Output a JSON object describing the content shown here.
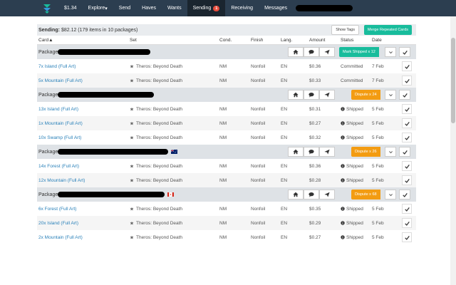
{
  "nav": {
    "balance": "$1.34",
    "items": [
      {
        "label": "Explore",
        "dropdown": true
      },
      {
        "label": "Send"
      },
      {
        "label": "Haves"
      },
      {
        "label": "Wants"
      },
      {
        "label": "Sending",
        "badge": "1",
        "active": true
      },
      {
        "label": "Receiving"
      },
      {
        "label": "Messages"
      }
    ]
  },
  "summary": {
    "label": "Sending:",
    "text": "$82.12 (179 items in 10 packages)",
    "show_tags": "Show Tags",
    "merge": "Merge Repeated Cards"
  },
  "columns": {
    "card": "Card▲",
    "set": "Set",
    "cond": "Cond.",
    "finish": "Finish",
    "lang": "Lang.",
    "amount": "Amount",
    "status": "Status",
    "date": "Date"
  },
  "colors": {
    "accent_green": "#18bc9c",
    "accent_orange": "#f39c12",
    "link": "#2980b9",
    "nav_bg": "#2c3e50"
  },
  "packages": [
    {
      "label": "Package",
      "action": "Mark Shipped x 12",
      "action_color": "green",
      "flag": "",
      "rows": [
        {
          "card": "7x Island (Full Art)",
          "set": "Theros: Beyond Death",
          "cond": "NM",
          "finish": "Nonfoil",
          "lang": "EN",
          "amount": "$0.36",
          "status": "Committed",
          "date": "7 Feb",
          "shipped": false
        },
        {
          "card": "5x Mountain (Full Art)",
          "set": "Theros: Beyond Death",
          "cond": "NM",
          "finish": "Nonfoil",
          "lang": "EN",
          "amount": "$0.33",
          "status": "Committed",
          "date": "7 Feb",
          "shipped": false
        }
      ]
    },
    {
      "label": "Package",
      "action": "Dispute x 24",
      "action_color": "orange",
      "flag": "",
      "rows": [
        {
          "card": "13x Island (Full Art)",
          "set": "Theros: Beyond Death",
          "cond": "NM",
          "finish": "Nonfoil",
          "lang": "EN",
          "amount": "$0.31",
          "status": "Shipped",
          "date": "5 Feb",
          "shipped": true
        },
        {
          "card": "1x Mountain (Full Art)",
          "set": "Theros: Beyond Death",
          "cond": "NM",
          "finish": "Nonfoil",
          "lang": "EN",
          "amount": "$0.27",
          "status": "Shipped",
          "date": "5 Feb",
          "shipped": true
        },
        {
          "card": "10x Swamp (Full Art)",
          "set": "Theros: Beyond Death",
          "cond": "NM",
          "finish": "Nonfoil",
          "lang": "EN",
          "amount": "$0.32",
          "status": "Shipped",
          "date": "5 Feb",
          "shipped": true
        }
      ]
    },
    {
      "label": "Package",
      "action": "Dispute x 26",
      "action_color": "orange",
      "flag": "au",
      "rows": [
        {
          "card": "14x Forest (Full Art)",
          "set": "Theros: Beyond Death",
          "cond": "NM",
          "finish": "Nonfoil",
          "lang": "EN",
          "amount": "$0.36",
          "status": "Shipped",
          "date": "5 Feb",
          "shipped": true
        },
        {
          "card": "12x Mountain (Full Art)",
          "set": "Theros: Beyond Death",
          "cond": "NM",
          "finish": "Nonfoil",
          "lang": "EN",
          "amount": "$0.28",
          "status": "Shipped",
          "date": "5 Feb",
          "shipped": true
        }
      ]
    },
    {
      "label": "Package",
      "action": "Dispute x 68",
      "action_color": "orange",
      "flag": "ca",
      "rows": [
        {
          "card": "6x Forest (Full Art)",
          "set": "Theros: Beyond Death",
          "cond": "NM",
          "finish": "Nonfoil",
          "lang": "EN",
          "amount": "$0.35",
          "status": "Shipped",
          "date": "5 Feb",
          "shipped": true
        },
        {
          "card": "20x Island (Full Art)",
          "set": "Theros: Beyond Death",
          "cond": "NM",
          "finish": "Nonfoil",
          "lang": "EN",
          "amount": "$0.29",
          "status": "Shipped",
          "date": "5 Feb",
          "shipped": true
        },
        {
          "card": "2x Mountain (Full Art)",
          "set": "Theros: Beyond Death",
          "cond": "NM",
          "finish": "Nonfoil",
          "lang": "EN",
          "amount": "$0.27",
          "status": "Shipped",
          "date": "5 Feb",
          "shipped": true
        }
      ]
    }
  ]
}
